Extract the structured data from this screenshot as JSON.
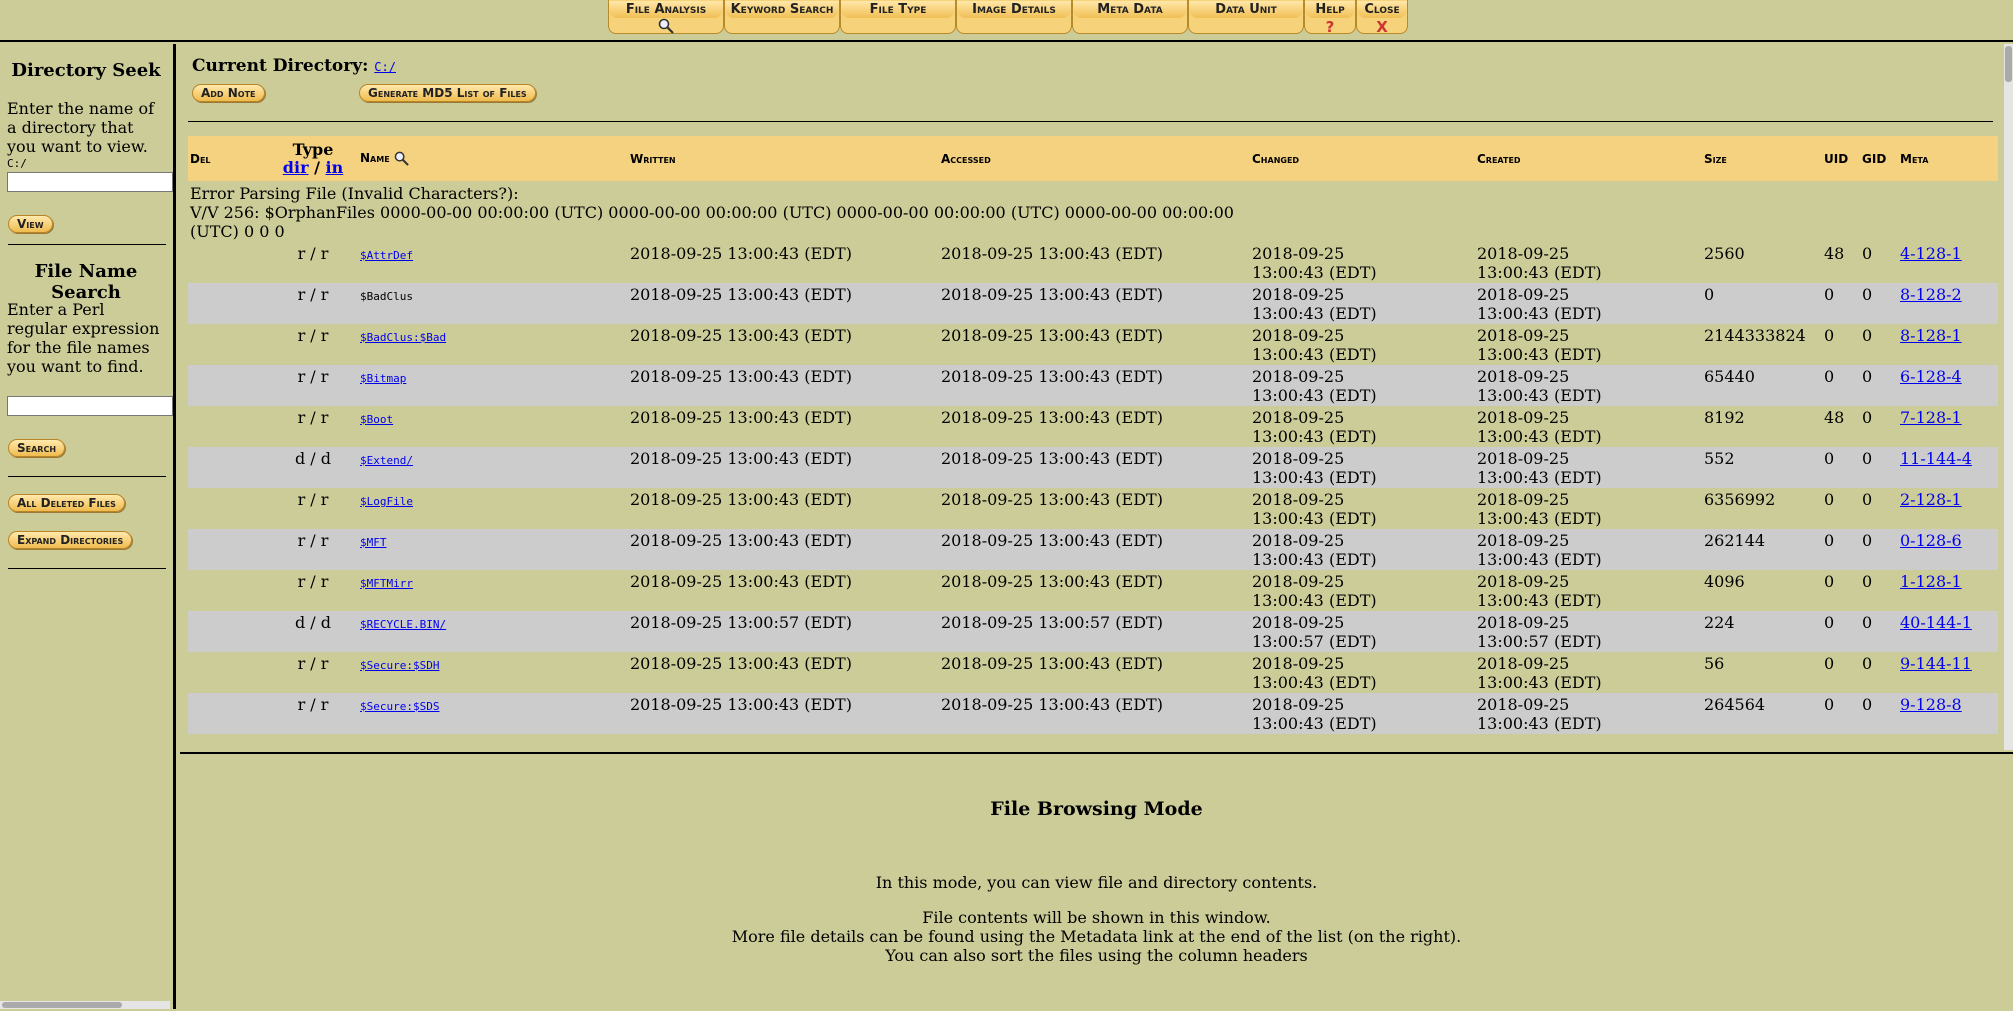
{
  "toolbar": {
    "tabs": [
      {
        "label": "File Analysis"
      },
      {
        "label": "Keyword Search"
      },
      {
        "label": "File Type"
      },
      {
        "label": "Image Details"
      },
      {
        "label": "Meta Data"
      },
      {
        "label": "Data Unit"
      },
      {
        "label": "Help",
        "sub": "?"
      },
      {
        "label": "Close",
        "sub": "X"
      }
    ]
  },
  "sidebar": {
    "dir_seek_title": "Directory Seek",
    "dir_seek_text": "Enter the name of a directory that you want to view.",
    "dir_input_value": "C:/",
    "view_button": "View",
    "name_search_title": "File Name Search",
    "name_search_text": "Enter a Perl regular expression for the file names you want to find.",
    "search_button": "Search",
    "deleted_button": "All Deleted Files",
    "expand_button": "Expand Directories"
  },
  "main": {
    "current_dir_label": "Current Directory:",
    "current_dir": "C:/",
    "add_note": "Add Note",
    "md5_button": "Generate MD5 List of Files",
    "headers": {
      "del": "Del",
      "type": "Type",
      "type_dir": "dir",
      "type_sep": " / ",
      "type_in": "in",
      "name": "Name",
      "written": "Written",
      "accessed": "Accessed",
      "changed": "Changed",
      "created": "Created",
      "size": "Size",
      "uid": "UID",
      "gid": "GID",
      "meta": "Meta"
    },
    "error_line1": "Error Parsing File (Invalid Characters?):",
    "error_line2": "V/V 256: $OrphanFiles 0000-00-00 00:00:00 (UTC) 0000-00-00 00:00:00 (UTC) 0000-00-00 00:00:00 (UTC) 0000-00-00 00:00:00",
    "error_line3": "(UTC) 0 0 0",
    "rows": [
      {
        "type": "r / r",
        "name": "$AttrDef",
        "link": true,
        "written": "2018-09-25 13:00:43 (EDT)",
        "accessed": "2018-09-25 13:00:43 (EDT)",
        "changed_d": "2018-09-25",
        "changed_t": "13:00:43 (EDT)",
        "created_d": "2018-09-25",
        "created_t": "13:00:43 (EDT)",
        "size": "2560",
        "uid": "48",
        "gid": "0",
        "meta": "4-128-1"
      },
      {
        "type": "r / r",
        "name": "$BadClus",
        "link": false,
        "written": "2018-09-25 13:00:43 (EDT)",
        "accessed": "2018-09-25 13:00:43 (EDT)",
        "changed_d": "2018-09-25",
        "changed_t": "13:00:43 (EDT)",
        "created_d": "2018-09-25",
        "created_t": "13:00:43 (EDT)",
        "size": "0",
        "uid": "0",
        "gid": "0",
        "meta": "8-128-2"
      },
      {
        "type": "r / r",
        "name": "$BadClus:$Bad",
        "link": true,
        "written": "2018-09-25 13:00:43 (EDT)",
        "accessed": "2018-09-25 13:00:43 (EDT)",
        "changed_d": "2018-09-25",
        "changed_t": "13:00:43 (EDT)",
        "created_d": "2018-09-25",
        "created_t": "13:00:43 (EDT)",
        "size": "2144333824",
        "uid": "0",
        "gid": "0",
        "meta": "8-128-1"
      },
      {
        "type": "r / r",
        "name": "$Bitmap",
        "link": true,
        "written": "2018-09-25 13:00:43 (EDT)",
        "accessed": "2018-09-25 13:00:43 (EDT)",
        "changed_d": "2018-09-25",
        "changed_t": "13:00:43 (EDT)",
        "created_d": "2018-09-25",
        "created_t": "13:00:43 (EDT)",
        "size": "65440",
        "uid": "0",
        "gid": "0",
        "meta": "6-128-4"
      },
      {
        "type": "r / r",
        "name": "$Boot",
        "link": true,
        "written": "2018-09-25 13:00:43 (EDT)",
        "accessed": "2018-09-25 13:00:43 (EDT)",
        "changed_d": "2018-09-25",
        "changed_t": "13:00:43 (EDT)",
        "created_d": "2018-09-25",
        "created_t": "13:00:43 (EDT)",
        "size": "8192",
        "uid": "48",
        "gid": "0",
        "meta": "7-128-1"
      },
      {
        "type": "d / d",
        "name": "$Extend/",
        "link": true,
        "written": "2018-09-25 13:00:43 (EDT)",
        "accessed": "2018-09-25 13:00:43 (EDT)",
        "changed_d": "2018-09-25",
        "changed_t": "13:00:43 (EDT)",
        "created_d": "2018-09-25",
        "created_t": "13:00:43 (EDT)",
        "size": "552",
        "uid": "0",
        "gid": "0",
        "meta": "11-144-4"
      },
      {
        "type": "r / r",
        "name": "$LogFile",
        "link": true,
        "written": "2018-09-25 13:00:43 (EDT)",
        "accessed": "2018-09-25 13:00:43 (EDT)",
        "changed_d": "2018-09-25",
        "changed_t": "13:00:43 (EDT)",
        "created_d": "2018-09-25",
        "created_t": "13:00:43 (EDT)",
        "size": "6356992",
        "uid": "0",
        "gid": "0",
        "meta": "2-128-1"
      },
      {
        "type": "r / r",
        "name": "$MFT",
        "link": true,
        "written": "2018-09-25 13:00:43 (EDT)",
        "accessed": "2018-09-25 13:00:43 (EDT)",
        "changed_d": "2018-09-25",
        "changed_t": "13:00:43 (EDT)",
        "created_d": "2018-09-25",
        "created_t": "13:00:43 (EDT)",
        "size": "262144",
        "uid": "0",
        "gid": "0",
        "meta": "0-128-6"
      },
      {
        "type": "r / r",
        "name": "$MFTMirr",
        "link": true,
        "written": "2018-09-25 13:00:43 (EDT)",
        "accessed": "2018-09-25 13:00:43 (EDT)",
        "changed_d": "2018-09-25",
        "changed_t": "13:00:43 (EDT)",
        "created_d": "2018-09-25",
        "created_t": "13:00:43 (EDT)",
        "size": "4096",
        "uid": "0",
        "gid": "0",
        "meta": "1-128-1"
      },
      {
        "type": "d / d",
        "name": "$RECYCLE.BIN/",
        "link": true,
        "written": "2018-09-25 13:00:57 (EDT)",
        "accessed": "2018-09-25 13:00:57 (EDT)",
        "changed_d": "2018-09-25",
        "changed_t": "13:00:57 (EDT)",
        "created_d": "2018-09-25",
        "created_t": "13:00:57 (EDT)",
        "size": "224",
        "uid": "0",
        "gid": "0",
        "meta": "40-144-1"
      },
      {
        "type": "r / r",
        "name": "$Secure:$SDH",
        "link": true,
        "written": "2018-09-25 13:00:43 (EDT)",
        "accessed": "2018-09-25 13:00:43 (EDT)",
        "changed_d": "2018-09-25",
        "changed_t": "13:00:43 (EDT)",
        "created_d": "2018-09-25",
        "created_t": "13:00:43 (EDT)",
        "size": "56",
        "uid": "0",
        "gid": "0",
        "meta": "9-144-11"
      },
      {
        "type": "r / r",
        "name": "$Secure:$SDS",
        "link": true,
        "written": "2018-09-25 13:00:43 (EDT)",
        "accessed": "2018-09-25 13:00:43 (EDT)",
        "changed_d": "2018-09-25",
        "changed_t": "13:00:43 (EDT)",
        "created_d": "2018-09-25",
        "created_t": "13:00:43 (EDT)",
        "size": "264564",
        "uid": "0",
        "gid": "0",
        "meta": "9-128-8"
      }
    ]
  },
  "bottom": {
    "title": "File Browsing Mode",
    "line1": "In this mode, you can view file and directory contents.",
    "line2": "File contents will be shown in this window.",
    "line3": "More file details can be found using the Metadata link at the end of the list (on the right).",
    "line4": "You can also sort the files using the column headers"
  }
}
